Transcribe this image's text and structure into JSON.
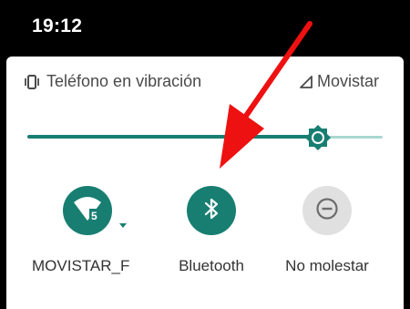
{
  "status_bar": {
    "time": "19:12"
  },
  "header": {
    "vibrate_label": "Teléfono en vibración",
    "carrier": "Movistar",
    "vibrate_icon": "vibrate-icon",
    "signal_icon": "signal-icon"
  },
  "brightness": {
    "level_percent": 82
  },
  "tiles": [
    {
      "label": "MOVISTAR_F",
      "icon": "wifi-icon",
      "badge": "5",
      "state": "on"
    },
    {
      "label": "Bluetooth",
      "icon": "bluetooth-icon",
      "state": "on"
    },
    {
      "label": "No molestar",
      "icon": "do-not-disturb-icon",
      "state": "off"
    }
  ],
  "colors": {
    "accent": "#187e72",
    "inactive_track": "#a9d7d0",
    "inactive_tile": "#e0e0e0",
    "annotation_arrow": "#ee1111"
  }
}
